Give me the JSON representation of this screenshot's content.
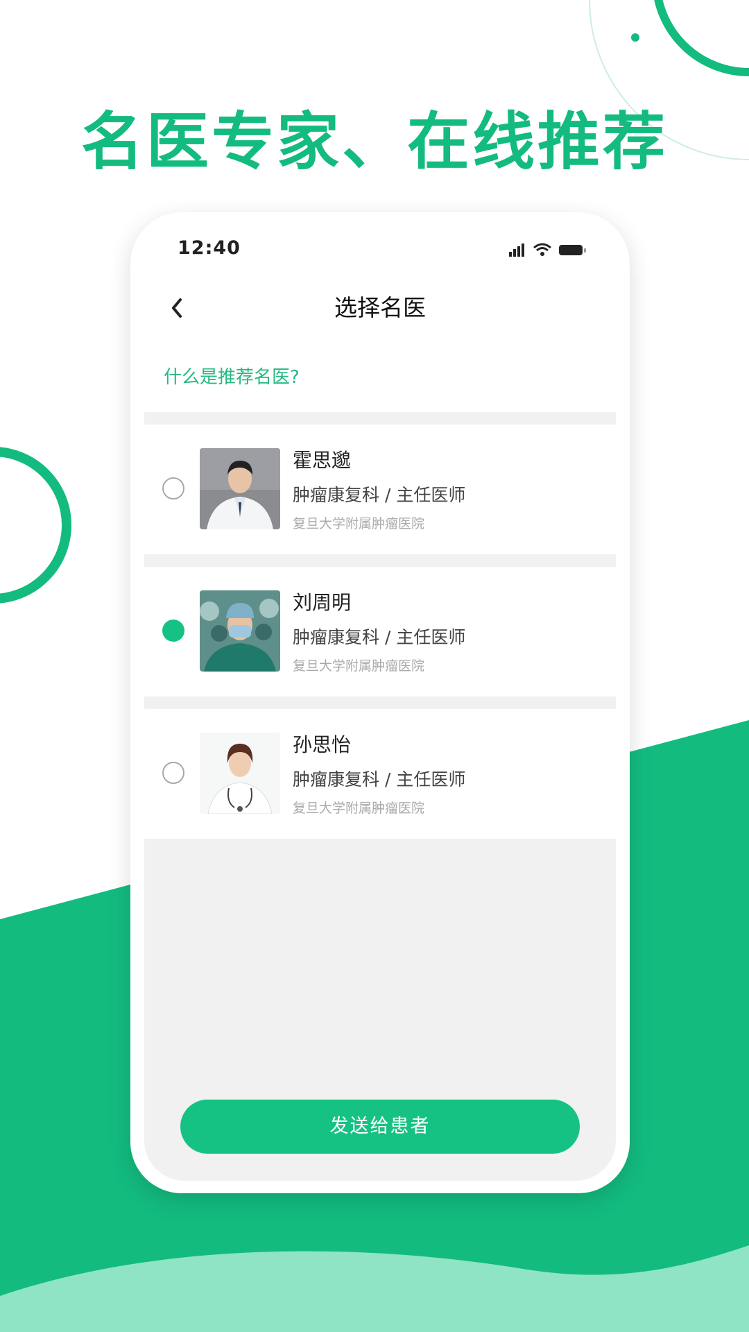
{
  "headline": "名医专家、在线推荐",
  "colors": {
    "brand_green": "#13bb7f",
    "light_green": "#8ee4c4",
    "selected_radio": "#16c283"
  },
  "status_bar": {
    "time": "12:40",
    "icons": [
      "signal-icon",
      "wifi-icon",
      "battery-icon"
    ]
  },
  "nav": {
    "back_icon": "chevron-left-icon",
    "title": "选择名医"
  },
  "info_link": "什么是推荐名医?",
  "doctors": [
    {
      "name": "霍思邈",
      "title": "肿瘤康复科 / 主任医师",
      "hospital": "复旦大学附属肿瘤医院",
      "selected": false,
      "avatar": "doctor-photo-white-coat"
    },
    {
      "name": "刘周明",
      "title": "肿瘤康复科 / 主任医师",
      "hospital": "复旦大学附属肿瘤医院",
      "selected": true,
      "avatar": "doctor-photo-surgical-scrubs"
    },
    {
      "name": "孙思怡",
      "title": "肿瘤康复科 / 主任医师",
      "hospital": "复旦大学附属肿瘤医院",
      "selected": false,
      "avatar": "doctor-photo-stethoscope"
    }
  ],
  "send_button": "发送给患者"
}
